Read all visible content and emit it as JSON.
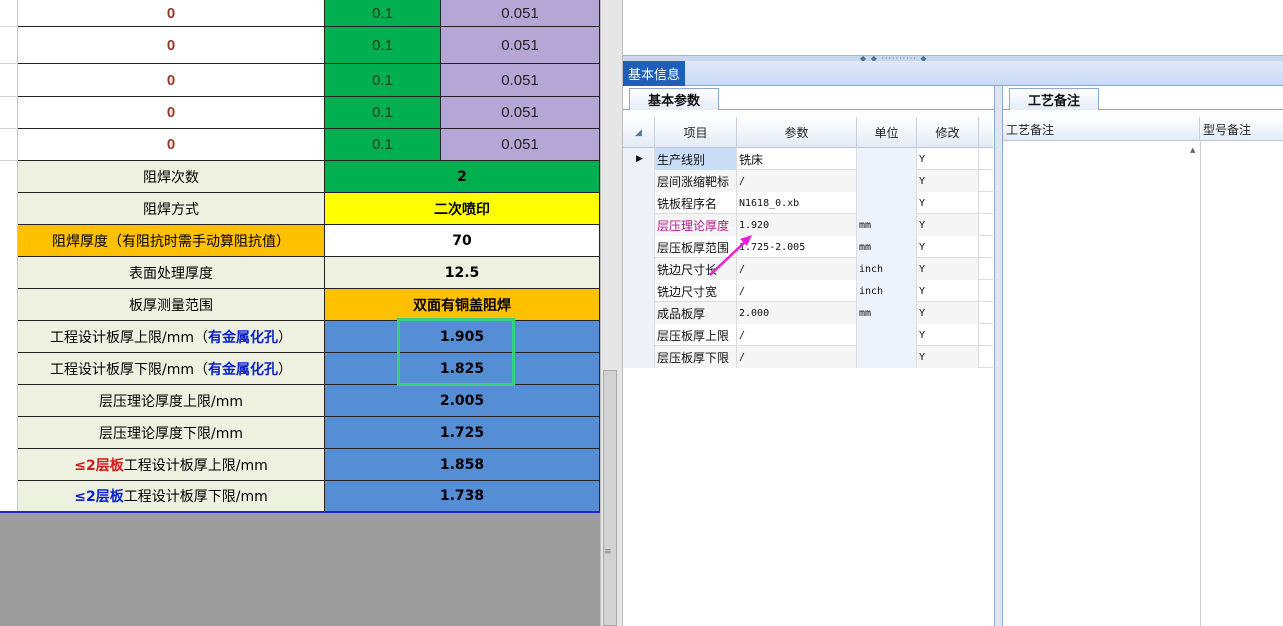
{
  "colors": {
    "green": "#00b050",
    "purple": "#b4a7d6",
    "cream": "#eef0e0",
    "orange": "#ffc000",
    "yellow": "#ffff00",
    "blue_cell": "#558ed5",
    "blue_text": "#0b22c8",
    "red_text": "#d21a1a",
    "highlight_box": "#36d07f",
    "annotation_arrow": "#e81fd6",
    "tab_active": "#1f5fb8"
  },
  "sheet": {
    "top_rows": [
      {
        "a": "0",
        "b": "0.1",
        "c": "0.051"
      },
      {
        "a": "0",
        "b": "0.1",
        "c": "0.051"
      },
      {
        "a": "0",
        "b": "0.1",
        "c": "0.051"
      },
      {
        "a": "0",
        "b": "0.1",
        "c": "0.051"
      },
      {
        "a": "0",
        "b": "0.1",
        "c": "0.051"
      }
    ],
    "rows": [
      {
        "label": "阻焊次数",
        "value": "2"
      },
      {
        "label": "阻焊方式",
        "value": "二次喷印"
      },
      {
        "label": "阻焊厚度（有阻抗时需手动算阻抗值）",
        "value": "70"
      },
      {
        "label": "表面处理厚度",
        "value": "12.5"
      },
      {
        "label": "板厚测量范围",
        "value": "双面有铜盖阻焊"
      },
      {
        "label_prefix": "工程设计板厚上限/mm（",
        "label_em": "有金属化孔",
        "label_suffix": "）",
        "value": "1.905"
      },
      {
        "label_prefix": "工程设计板厚下限/mm（",
        "label_em": "有金属化孔",
        "label_suffix": "）",
        "value": "1.825"
      },
      {
        "label": "层压理论厚度上限/mm",
        "value": "2.005"
      },
      {
        "label": "层压理论厚度下限/mm",
        "value": "1.725"
      },
      {
        "label_em": "≤2层板",
        "label_suffix": "工程设计板厚上限/mm",
        "value": "1.858"
      },
      {
        "label_em": "≤2层板",
        "label_suffix": "工程设计板厚下限/mm",
        "value": "1.738"
      }
    ]
  },
  "panel": {
    "main_tab": "基本信息",
    "left_subtab": "基本参数",
    "right_subtab": "工艺备注",
    "grid_headers": {
      "item": "项目",
      "param": "参数",
      "unit": "单位",
      "modify": "修改"
    },
    "grid_rows": [
      {
        "item": "生产线别",
        "param": "铣床",
        "unit": "",
        "modify": "Y"
      },
      {
        "item": "层间涨缩靶标",
        "param": "/",
        "unit": "",
        "modify": "Y"
      },
      {
        "item": "铣板程序名",
        "param": "N1618_0.xb",
        "unit": "",
        "modify": "Y"
      },
      {
        "item": "层压理论厚度",
        "param": "1.920",
        "unit": "mm",
        "modify": "Y"
      },
      {
        "item": "层压板厚范围",
        "param": "1.725-2.005",
        "unit": "mm",
        "modify": "Y"
      },
      {
        "item": "铣边尺寸长",
        "param": "/",
        "unit": "inch",
        "modify": "Y"
      },
      {
        "item": "铣边尺寸宽",
        "param": "/",
        "unit": "inch",
        "modify": "Y"
      },
      {
        "item": "成品板厚",
        "param": "2.000",
        "unit": "mm",
        "modify": "Y"
      },
      {
        "item": "层压板厚上限",
        "param": "/",
        "unit": "",
        "modify": "Y"
      },
      {
        "item": "层压板厚下限",
        "param": "/",
        "unit": "",
        "modify": "Y"
      }
    ],
    "notes_headers": {
      "process_note": "工艺备注",
      "model_note": "型号备注"
    }
  }
}
